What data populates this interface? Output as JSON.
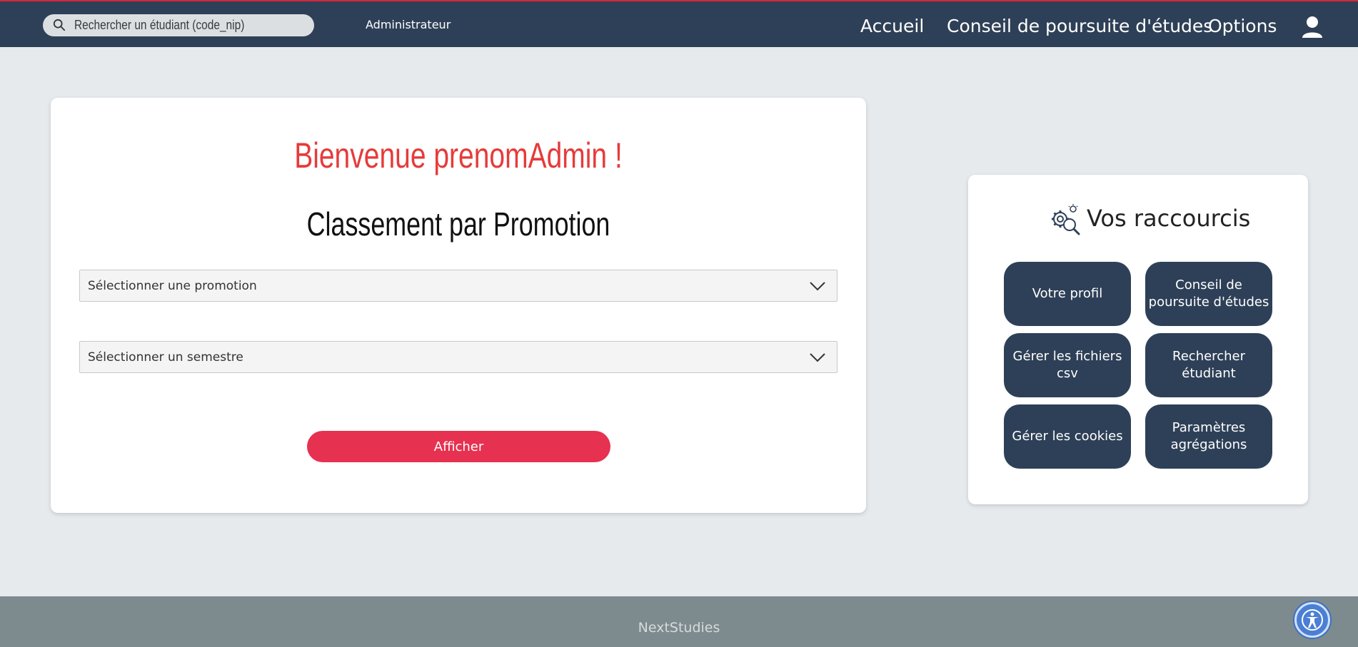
{
  "header": {
    "search_placeholder": "Rechercher un étudiant (code_nip)",
    "role": "Administrateur",
    "nav": {
      "accueil": "Accueil",
      "conseil": "Conseil de poursuite d'études",
      "options": "Options"
    }
  },
  "main": {
    "welcome": "Bienvenue prenomAdmin !",
    "title": "Classement par Promotion",
    "select_promotion": "Sélectionner une promotion",
    "select_semestre": "Sélectionner un semestre",
    "button": "Afficher"
  },
  "shortcuts": {
    "title": "Vos raccourcis",
    "items": [
      "Votre profil",
      "Conseil de poursuite d'études",
      "Gérer les fichiers csv",
      "Rechercher étudiant",
      "Gérer les cookies",
      "Paramètres agrégations"
    ]
  },
  "footer": {
    "brand": "NextStudies"
  },
  "colors": {
    "primary": "#2e4057",
    "accent": "#e63150",
    "welcome": "#e63b3b",
    "background": "#e6eaed",
    "footer": "#7d8b8f"
  }
}
